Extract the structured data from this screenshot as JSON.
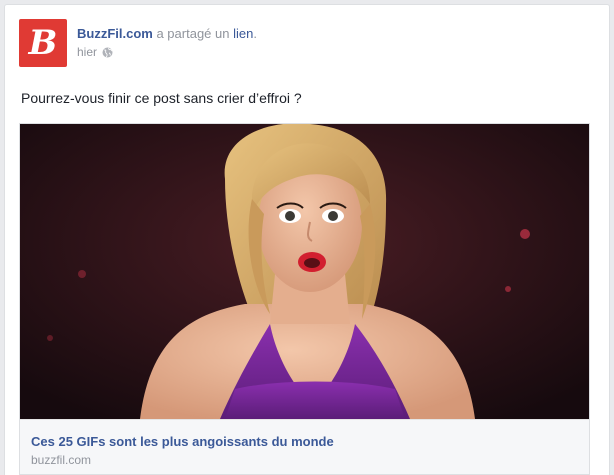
{
  "post": {
    "author": "BuzzFil.com",
    "action_text": "a partagé un",
    "action_link": "lien",
    "action_end": ".",
    "timestamp": "hier",
    "avatar_letter": "B",
    "message": "Pourrez-vous finir ce post sans crier d’effroi ?",
    "audience_icon": "globe-icon"
  },
  "link_card": {
    "title": "Ces 25 GIFs sont les plus angoissants du monde",
    "domain": "buzzfil.com"
  },
  "colors": {
    "brand_red": "#e03a34",
    "link_blue": "#3b5998",
    "meta_gray": "#90949c",
    "caption_bg": "#f6f7f9"
  }
}
